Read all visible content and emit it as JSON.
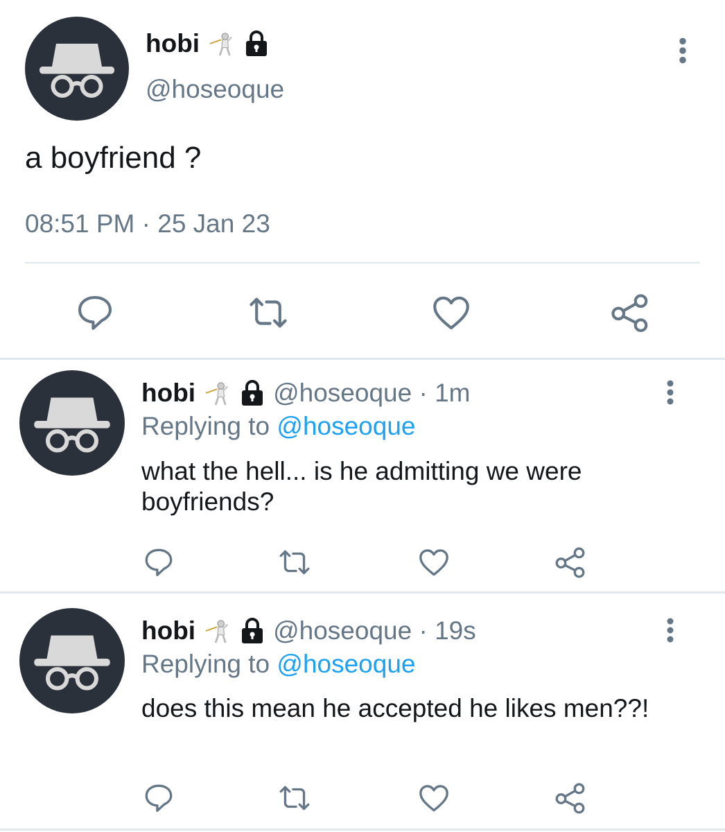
{
  "main_tweet": {
    "name": "hobi",
    "handle": "@hoseoque",
    "text": "a boyfriend ?",
    "timestamp": "08:51 PM · 25 Jan 23",
    "icons": {
      "avatar": "incognito-icon",
      "badge1": "fencer-emoji",
      "badge2": "lock-icon",
      "more": "more-vertical-icon"
    },
    "actions": [
      "reply-icon",
      "retweet-icon",
      "like-icon",
      "share-icon"
    ]
  },
  "replies": [
    {
      "name": "hobi",
      "handle_time": "@hoseoque · 1m",
      "replying_label": "Replying to",
      "replying_handle": "@hoseoque",
      "text": "what the hell... is he admitting we were boyfriends?"
    },
    {
      "name": "hobi",
      "handle_time": "@hoseoque · 19s",
      "replying_label": "Replying to",
      "replying_handle": "@hoseoque",
      "text": "does this mean he accepted he likes men??!"
    }
  ],
  "colors": {
    "text": "#14171a",
    "secondary": "#657786",
    "link": "#1da1f2",
    "avatar_bg": "#2b313a",
    "divider": "#e1e8ed"
  }
}
